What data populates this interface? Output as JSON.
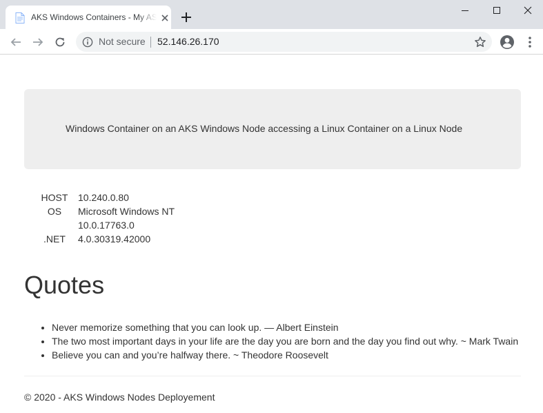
{
  "browser": {
    "tab_title": "AKS Windows Containers - My ASP.NET Application",
    "security_label": "Not secure",
    "url": "52.146.26.170"
  },
  "page": {
    "jumbotron_text": "Windows Container on an AKS Windows Node accessing a Linux Container on a Linux Node",
    "info": [
      {
        "key": "HOST",
        "value": "10.240.0.80"
      },
      {
        "key": "OS",
        "value": "Microsoft Windows NT"
      },
      {
        "key": "",
        "value": "10.0.17763.0"
      },
      {
        "key": ".NET",
        "value": "4.0.30319.42000"
      }
    ],
    "quotes_title": "Quotes",
    "quotes": [
      "Never memorize something that you can look up. — Albert Einstein",
      "The two most important days in your life are the day you are born and the day you find out why. ~ Mark Twain",
      "Believe you can and you’re halfway there. ~ Theodore Roosevelt"
    ],
    "footer": "© 2020 - AKS Windows Nodes Deployement"
  },
  "icons": {
    "favicon": "document-icon",
    "tab_close": "close-icon",
    "new_tab": "plus-icon",
    "back": "arrow-left-icon",
    "forward": "arrow-right-icon",
    "reload": "reload-icon",
    "info": "info-icon",
    "bookmark": "star-icon",
    "profile": "account-icon",
    "menu": "kebab-menu-icon",
    "minimize": "minimize-icon",
    "maximize": "maximize-icon",
    "close_window": "close-window-icon"
  }
}
